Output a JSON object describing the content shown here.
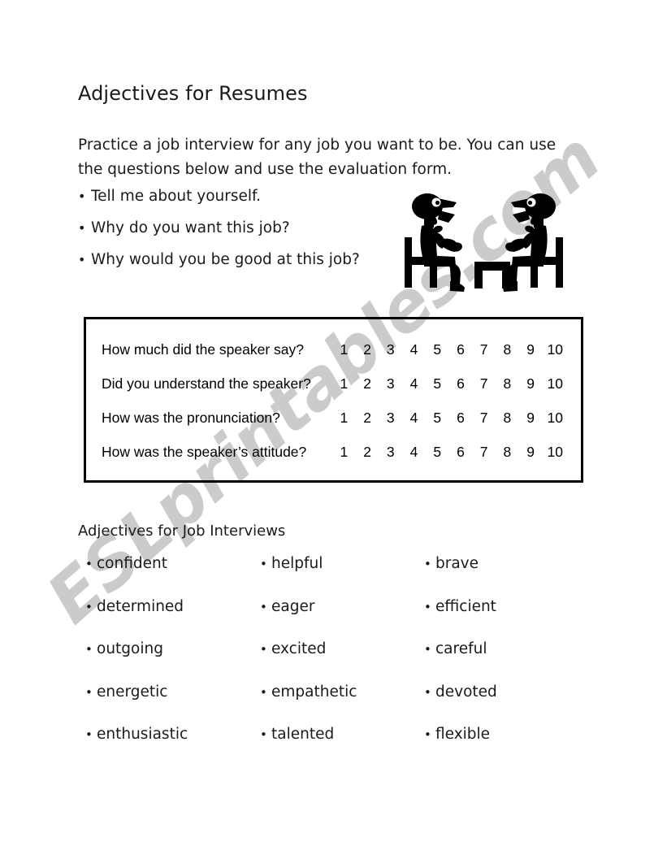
{
  "document": {
    "title": "Adjectives for Resumes",
    "intro": "Practice a job interview for any job you want to be.  You can use the questions below and use the evaluation form.",
    "bullet_glyph": "•"
  },
  "interview_questions": [
    {
      "text": "Tell me about yourself."
    },
    {
      "text": "Why do you want this job?"
    },
    {
      "text": "Why would you be good at this job?"
    }
  ],
  "illustration": {
    "name": "two-people-job-interview-clipart",
    "description": "Two black silhouette figures seated on chairs facing each other across a small table, one speaking"
  },
  "evaluation_form": {
    "scale": [
      "1",
      "2",
      "3",
      "4",
      "5",
      "6",
      "7",
      "8",
      "9",
      "10"
    ],
    "rows": [
      {
        "question": "How much did the speaker say?"
      },
      {
        "question": "Did you understand the speaker?"
      },
      {
        "question": "How was the pronunciation?"
      },
      {
        "question": "How was the speaker’s attitude?"
      }
    ]
  },
  "adjectives_section": {
    "heading": "Adjectives for Job Interviews",
    "rows": [
      {
        "col0": "confident",
        "col1": "helpful",
        "col2": "brave"
      },
      {
        "col0": "determined",
        "col1": "eager",
        "col2": "efficient"
      },
      {
        "col0": "outgoing",
        "col1": "excited",
        "col2": "careful"
      },
      {
        "col0": "energetic",
        "col1": "empathetic",
        "col2": "devoted"
      },
      {
        "col0": "enthusiastic",
        "col1": "talented",
        "col2": "flexible"
      }
    ]
  },
  "watermark": {
    "text": "ESLprintables.com",
    "color": "#c9c9c9"
  },
  "colors": {
    "page_background": "#ffffff",
    "text": "#1a1a1a",
    "box_border": "#000000",
    "clipart_fill": "#000000"
  }
}
